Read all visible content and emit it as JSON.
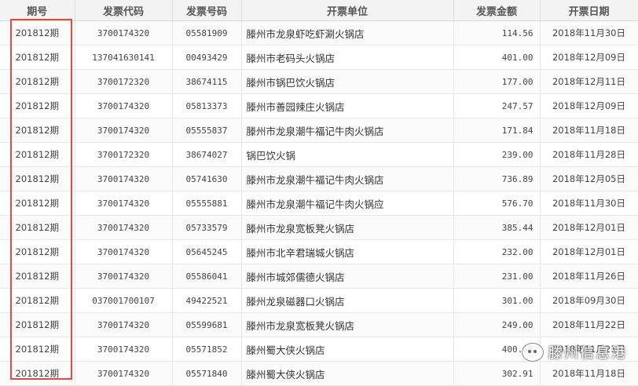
{
  "table": {
    "headers": [
      "期号",
      "发票代码",
      "发票号码",
      "开票单位",
      "发票金额",
      "开票日期"
    ],
    "rows": [
      {
        "period": "201812期",
        "code": "3700174320",
        "number": "05581909",
        "unit": "滕州市龙泉虾吃虾涮火锅店",
        "amount": "114.56",
        "date": "2018年11月30日"
      },
      {
        "period": "201812期",
        "code": "137041630141",
        "number": "00493429",
        "unit": "滕州市老码头火锅店",
        "amount": "401.00",
        "date": "2018年12月09日"
      },
      {
        "period": "201812期",
        "code": "3700172320",
        "number": "38674115",
        "unit": "滕州市锅巴饮火锅店",
        "amount": "177.00",
        "date": "2018年12月11日"
      },
      {
        "period": "201812期",
        "code": "3700174320",
        "number": "05813373",
        "unit": "滕州市善园辣庄火锅店",
        "amount": "247.57",
        "date": "2018年12月09日"
      },
      {
        "period": "201812期",
        "code": "3700174320",
        "number": "05555837",
        "unit": "滕州市龙泉潮牛福记牛肉火锅店",
        "amount": "171.84",
        "date": "2018年11月18日"
      },
      {
        "period": "201812期",
        "code": "3700172320",
        "number": "38674027",
        "unit": "锅巴饮火锅",
        "amount": "239.00",
        "date": "2018年11月28日"
      },
      {
        "period": "201812期",
        "code": "3700174320",
        "number": "05741630",
        "unit": "滕州市龙泉潮牛福记牛肉火锅店",
        "amount": "736.89",
        "date": "2018年12月05日"
      },
      {
        "period": "201812期",
        "code": "3700174320",
        "number": "05555881",
        "unit": "滕州市龙泉潮牛福记牛肉火锅应",
        "amount": "576.70",
        "date": "2018年11月30日"
      },
      {
        "period": "201812期",
        "code": "3700174320",
        "number": "05733579",
        "unit": "滕州市龙泉宽板凳火锅店",
        "amount": "385.44",
        "date": "2018年12月01日"
      },
      {
        "period": "201812期",
        "code": "3700174320",
        "number": "05645245",
        "unit": "滕州市北辛君瑞城火锅店",
        "amount": "232.00",
        "date": "2018年12月01日"
      },
      {
        "period": "201812期",
        "code": "3700174320",
        "number": "05586041",
        "unit": "滕州市城郊儒德火锅店",
        "amount": "231.00",
        "date": "2018年11月26日"
      },
      {
        "period": "201812期",
        "code": "037001700107",
        "number": "49422521",
        "unit": "滕州龙泉磁器口火锅店",
        "amount": "301.00",
        "date": "2018年09月30日"
      },
      {
        "period": "201812期",
        "code": "3700174320",
        "number": "05599681",
        "unit": "滕州市龙泉宽板凳火锅店",
        "amount": "249.00",
        "date": "2018年11月22日"
      },
      {
        "period": "201812期",
        "code": "3700174320",
        "number": "05571852",
        "unit": "滕州蜀大侠火锅店",
        "amount": "400.00",
        "date": "2018年11月21日"
      },
      {
        "period": "201812期",
        "code": "3700174320",
        "number": "05571840",
        "unit": "滕州蜀大侠火锅店",
        "amount": "302.91",
        "date": "2018年11月18日"
      }
    ]
  },
  "watermark": {
    "text": "滕州信息港",
    "icon": "wechat-icon"
  },
  "colors": {
    "highlight": "#e24a4a",
    "header_bg": "#f3f3f3"
  }
}
